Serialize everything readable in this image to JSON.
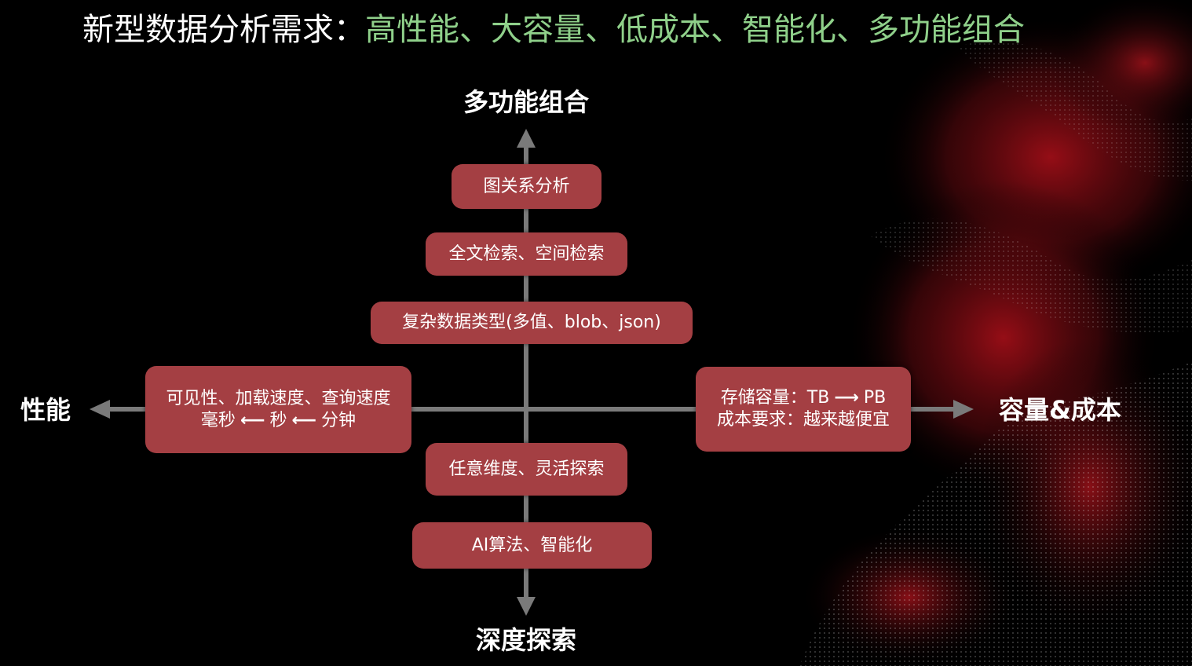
{
  "title": {
    "prefix": "新型数据分析需求：",
    "highlight": "高性能、大容量、低成本、智能化、多功能组合"
  },
  "axes": {
    "top": "多功能组合",
    "bottom": "深度探索",
    "left": "性能",
    "right": "容量&成本"
  },
  "boxes": {
    "graph": "图关系分析",
    "fulltext": "全文检索、空间检索",
    "complex": "复杂数据类型(多值、blob、json)",
    "perf_line1": "可见性、加载速度、查询速度",
    "perf_ms": "毫秒",
    "perf_s": "秒",
    "perf_min": "分钟",
    "cap_line1_prefix": "存储容量：TB",
    "cap_line1_suffix": "PB",
    "cap_line2": "成本要求：越来越便宜",
    "explore": "任意维度、灵活探索",
    "ai": "AI算法、智能化"
  },
  "colors": {
    "background": "#000000",
    "box": "#a43f43",
    "title_highlight": "#8fd08a",
    "axis": "#7a7a7a"
  }
}
